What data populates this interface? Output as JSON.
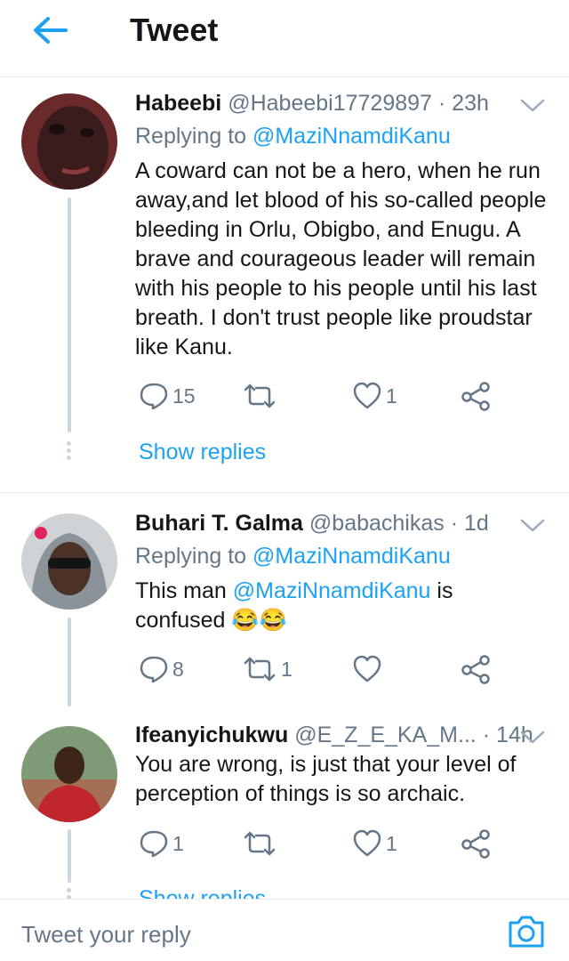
{
  "header": {
    "title": "Tweet",
    "back_icon": "arrow-left-icon"
  },
  "tweets": [
    {
      "name": "Habeebi",
      "handle": "@Habeebi17729897 · 23h",
      "replying_prefix": "Replying to ",
      "replying_to": "@MaziNnamdiKanu",
      "body_lines": [
        "A coward can not be a hero, when he run",
        "away,and let blood of his so-called people",
        "bleeding in Orlu, Obigbo, and Enugu. A",
        "brave and courageous leader will remain",
        "with his people to his people until his last",
        "breath. I don't trust people like proudstar",
        "like Kanu."
      ],
      "replies": "15",
      "retweets": "",
      "likes": "1",
      "show_replies": "Show replies"
    },
    {
      "name": "Buhari T. Galma",
      "handle": "@babachikas · 1d",
      "replying_prefix": "Replying to ",
      "replying_to": "@MaziNnamdiKanu",
      "body_pre": "This man ",
      "body_mention": "@MaziNnamdiKanu",
      "body_post": " is",
      "body_line2": "confused 😂😂",
      "replies": "8",
      "retweets": "1",
      "likes": ""
    },
    {
      "name": "Ifeanyichukwu",
      "handle": "@E_Z_E_KA_M... · 14h",
      "body_lines": [
        "You are wrong, is just that your level of",
        "perception of things is so archaic."
      ],
      "replies": "1",
      "retweets": "",
      "likes": "1",
      "show_replies": "Show replies"
    }
  ],
  "composer": {
    "placeholder": "Tweet your reply",
    "camera_icon": "camera-icon"
  },
  "colors": {
    "accent": "#1da1f2",
    "muted": "#657786",
    "text": "#14171a",
    "divider": "#e6ecf0"
  }
}
